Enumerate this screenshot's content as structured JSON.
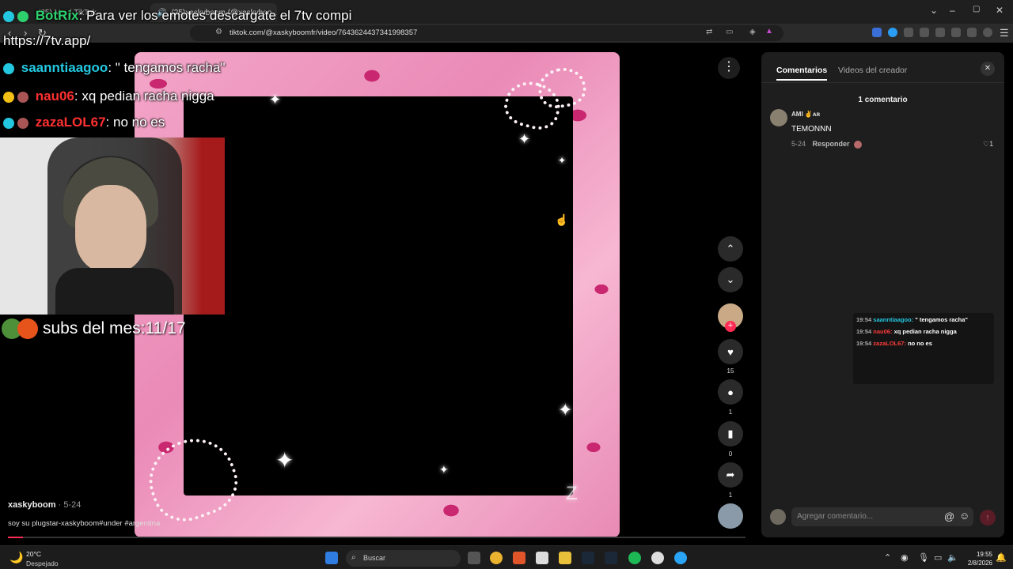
{
  "browser": {
    "tabs": [
      {
        "label": "(35) M... | TikTok"
      },
      {
        "label": "(25)xaskyboom (@xaskyboo..."
      }
    ],
    "url": "tiktok.com/@xaskyboomfr/video/7643624437341998357",
    "controls": {
      "minimize": "–",
      "maximize": "▢",
      "close": "✕",
      "dropdown": "⌄"
    }
  },
  "overlay": {
    "lines": [
      {
        "user": "BotRix",
        "message": ": Para ver los emotes descargate el 7tv compi",
        "user_color": "#2ed06e"
      },
      {
        "user": "",
        "message": "https://7tv.app/",
        "user_color": "#ffffff"
      },
      {
        "user": "saanntiaagoo",
        "message": ": \" tengamos racha\"",
        "user_color": "#23c8e0"
      },
      {
        "user": "nau06",
        "message": ": xq pedian racha nigga",
        "user_color": "#ff3030"
      },
      {
        "user": "zazaLOL67",
        "message": ": no no es",
        "user_color": "#ff3030"
      }
    ],
    "subs_text": "subs del mes:11/17"
  },
  "video": {
    "author": "xaskyboom",
    "date": "· 5-24",
    "caption": "soy su plugstar-xaskyboom#under #argentina",
    "progress": 0.02,
    "actions": {
      "likes": "15",
      "comments": "1",
      "saves": "0",
      "shares": "1"
    }
  },
  "comments_panel": {
    "tabs": [
      "Comentarios",
      "Videos del creador"
    ],
    "count_title": "1 comentario",
    "comment": {
      "name": "AMI ✌️ᴀʀ",
      "text": "TEMONNN",
      "date": "5-24",
      "reply_label": "Responder",
      "likes": "1"
    },
    "mini_chat": [
      {
        "time": "19:54",
        "user": "saanntiaagoo:",
        "message": "\" tengamos racha\"",
        "user_color": "blue"
      },
      {
        "time": "19:54",
        "user": "nau06:",
        "message": "xq pedian racha nigga",
        "user_color": "red"
      },
      {
        "time": "19:54",
        "user": "zazaLOL67:",
        "message": "no no es",
        "user_color": "red"
      }
    ],
    "input_placeholder": "Agregar comentario..."
  },
  "taskbar": {
    "temp": "20°C",
    "weather": "Despejado",
    "search": "Buscar",
    "time": "19:55",
    "date": "2/8/2026"
  },
  "colors": {
    "tiktok_red": "#fe2c55",
    "panel_bg": "#1e1e1e",
    "pink_frame": "#f3a6c8"
  }
}
